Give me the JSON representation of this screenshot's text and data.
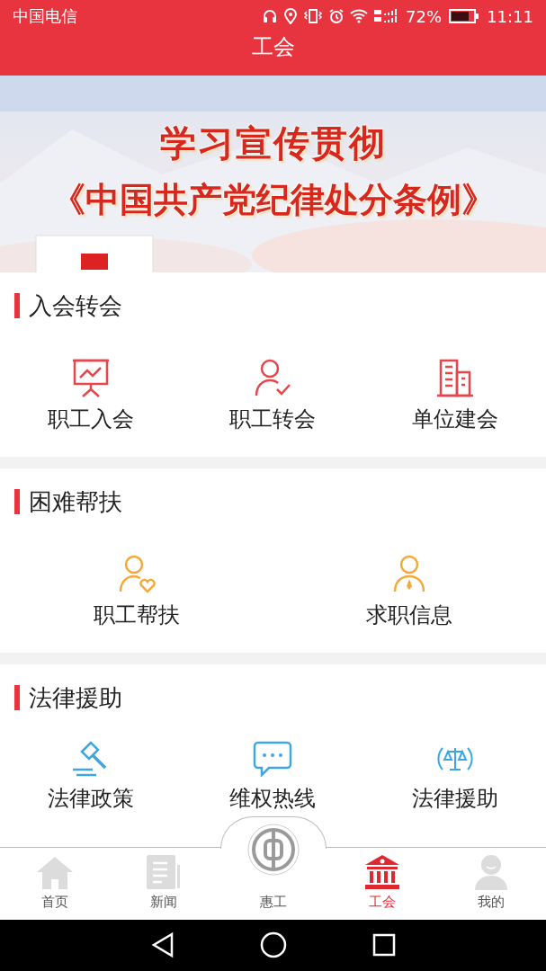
{
  "status_bar": {
    "carrier": "中国电信",
    "battery": "72%",
    "time": "11:11"
  },
  "header": {
    "title": "工会"
  },
  "banner": {
    "lines": [
      "学习宣传贯彻",
      "《中国共产党纪律处分条例》"
    ]
  },
  "sections": [
    {
      "title": "入会转会",
      "items": [
        {
          "label": "职工入会"
        },
        {
          "label": "职工转会"
        },
        {
          "label": "单位建会"
        }
      ]
    },
    {
      "title": "困难帮扶",
      "items": [
        {
          "label": "职工帮扶"
        },
        {
          "label": "求职信息"
        }
      ]
    },
    {
      "title": "法律援助",
      "items": [
        {
          "label": "法律政策"
        },
        {
          "label": "维权热线"
        },
        {
          "label": "法律援助"
        }
      ]
    }
  ],
  "tab_bar": [
    {
      "kind": "tab",
      "label": "首页",
      "selected": false
    },
    {
      "kind": "tab",
      "label": "新闻",
      "selected": false
    },
    {
      "kind": "center",
      "label": "惠工",
      "selected": false
    },
    {
      "kind": "tab",
      "label": "工会",
      "selected": true
    },
    {
      "kind": "tab",
      "label": "我的",
      "selected": false
    }
  ]
}
